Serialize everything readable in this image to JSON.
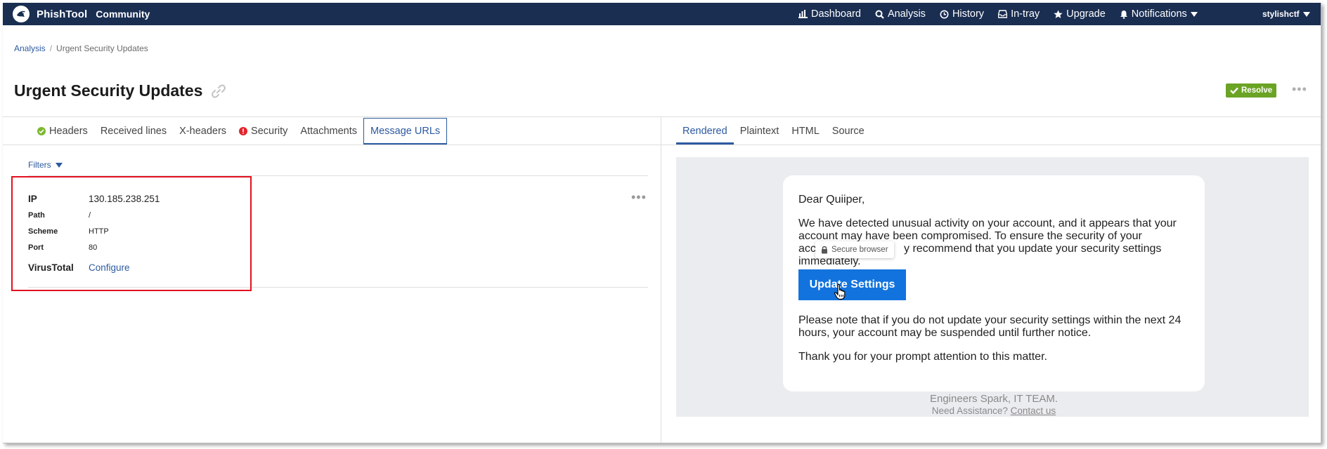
{
  "topnav": {
    "brand": "PhishTool",
    "edition": "Community",
    "items": [
      {
        "label": "Dashboard",
        "icon": "bar-chart-icon"
      },
      {
        "label": "Analysis",
        "icon": "search-icon"
      },
      {
        "label": "History",
        "icon": "clock-icon"
      },
      {
        "label": "In-tray",
        "icon": "inbox-icon"
      },
      {
        "label": "Upgrade",
        "icon": "star-icon"
      },
      {
        "label": "Notifications",
        "icon": "bell-icon"
      }
    ],
    "user": "stylishctf"
  },
  "breadcrumb": {
    "parent": "Analysis",
    "current": "Urgent Security Updates"
  },
  "page": {
    "title": "Urgent Security Updates",
    "resolve_label": "Resolve",
    "more": "•••"
  },
  "left_tabs": [
    {
      "label": "Headers",
      "status": "ok"
    },
    {
      "label": "Received lines"
    },
    {
      "label": "X-headers"
    },
    {
      "label": "Security",
      "status": "alert"
    },
    {
      "label": "Attachments"
    },
    {
      "label": "Message URLs",
      "active": true
    }
  ],
  "right_tabs": [
    {
      "label": "Rendered",
      "active": true
    },
    {
      "label": "Plaintext"
    },
    {
      "label": "HTML"
    },
    {
      "label": "Source"
    }
  ],
  "filters_label": "Filters",
  "url_entry": {
    "ip_label": "IP",
    "ip": "130.185.238.251",
    "path_label": "Path",
    "path": "/",
    "scheme_label": "Scheme",
    "scheme": "HTTP",
    "port_label": "Port",
    "port": "80",
    "virustotal_label": "VirusTotal",
    "virustotal_action": "Configure",
    "more": "•••"
  },
  "email": {
    "greeting": "Dear Quiiper,",
    "p1_line1": "We have detected unusual activity on your account, and it appears that your",
    "p1_line2": "account may have been compromised. To ensure the security of your",
    "p1_line3_start": "acc",
    "p1_line3_end": "y recommend that you update your security settings",
    "p1_line4": "immediately.",
    "button": "Update Settings",
    "tooltip": "Secure browser",
    "p2_line1": "Please note that if you do not update your security settings within the next 24",
    "p2_line2": "hours, your account may be suspended until further notice.",
    "p3": "Thank you for your prompt attention to this matter.",
    "signature": "Engineers Spark, IT TEAM.",
    "help_text": "Need Assistance?",
    "help_link": "Contact us"
  },
  "colors": {
    "nav_bg": "#1a2e52",
    "link": "#2c5aa0",
    "resolve": "#6ba324",
    "highlight_box": "#e3101e",
    "email_button": "#1273de",
    "ok_status": "#7cb82f",
    "alert_status": "#e3242b"
  }
}
